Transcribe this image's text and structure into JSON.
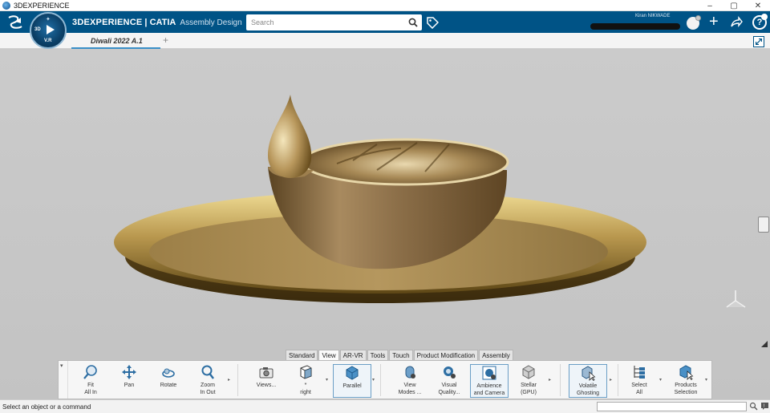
{
  "window": {
    "title": "3DEXPERIENCE",
    "controls": [
      "–",
      "▢",
      "✕"
    ]
  },
  "header": {
    "brand_bold": "3DEXPERIENCE",
    "brand_app": " | CATIA",
    "brand_sub": "Assembly Design",
    "compass_version": "V.R",
    "compass_3d": "3D",
    "search": {
      "placeholder": "Search"
    },
    "user_name": "Kiran NIKWADE",
    "plus": "+",
    "help": "?"
  },
  "tabs": {
    "doc_tab": "Diwali 2022 A.1",
    "add": "+"
  },
  "action_tabs": [
    "Standard",
    "View",
    "AR-VR",
    "Tools",
    "Touch",
    "Product Modification",
    "Assembly"
  ],
  "action_tab_active": "View",
  "commands": {
    "fit_all_in": "Fit\nAll In",
    "pan": "Pan",
    "rotate": "Rotate",
    "zoom_in_out": "Zoom\nIn Out",
    "views": "Views...",
    "right": "*\nright",
    "parallel": "Parallel",
    "view_modes": "View\nModes ...",
    "visual_quality": "Visual\nQuality...",
    "ambience_camera": "Ambience\nand Camera",
    "stellar_gpu": "Stellar\n(GPU)",
    "volatile_ghosting": "Volatile\nGhosting",
    "select_all": "Select\nAll",
    "products_selection": "Products\nSelection"
  },
  "status": {
    "prompt": "Select an object or a command"
  },
  "colors": {
    "header": "#005386",
    "viewport": "#c7c7c7",
    "gold": "#b8974e",
    "accent": "#3a8fc8"
  }
}
